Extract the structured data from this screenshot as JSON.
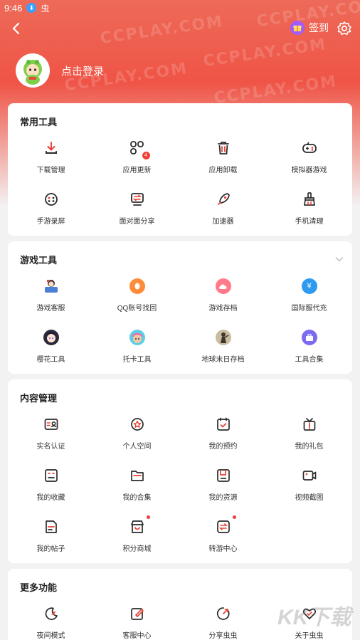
{
  "status": {
    "time": "9:46",
    "app_glyph": "虫"
  },
  "header": {
    "checkin_label": "签到",
    "watermark": "CCPLAY.COM"
  },
  "profile": {
    "login_text": "点击登录"
  },
  "sections": [
    {
      "title": "常用工具",
      "items": [
        {
          "label": "下载管理",
          "icon": "download-icon"
        },
        {
          "label": "应用更新",
          "icon": "apps-update-icon",
          "badge": "4"
        },
        {
          "label": "应用卸载",
          "icon": "trash-icon"
        },
        {
          "label": "模拟器游戏",
          "icon": "gamepad-icon"
        },
        {
          "label": "手游录屏",
          "icon": "record-icon"
        },
        {
          "label": "面对面分享",
          "icon": "share-screen-icon"
        },
        {
          "label": "加速器",
          "icon": "rocket-icon"
        },
        {
          "label": "手机清理",
          "icon": "broom-icon"
        }
      ]
    },
    {
      "title": "游戏工具",
      "items": [
        {
          "label": "游戏客服",
          "icon": "customer-service-icon"
        },
        {
          "label": "QQ账号找回",
          "icon": "qq-icon",
          "color": "#ff8c3a"
        },
        {
          "label": "游戏存档",
          "icon": "cloud-save-icon",
          "color": "#ff7a8a"
        },
        {
          "label": "国际服代充",
          "icon": "yen-icon",
          "color": "#2e9bf0"
        },
        {
          "label": "樱花工具",
          "icon": "sakura-avatar-icon"
        },
        {
          "label": "托卡工具",
          "icon": "toca-avatar-icon"
        },
        {
          "label": "地球末日存档",
          "icon": "doomsday-avatar-icon"
        },
        {
          "label": "工具合集",
          "icon": "toolbox-icon",
          "color": "#7b6bf0"
        }
      ]
    },
    {
      "title": "内容管理",
      "items": [
        {
          "label": "实名认证",
          "icon": "id-card-icon"
        },
        {
          "label": "个人空间",
          "icon": "star-space-icon"
        },
        {
          "label": "我的预约",
          "icon": "calendar-check-icon"
        },
        {
          "label": "我的礼包",
          "icon": "gift-box-icon"
        },
        {
          "label": "我的收藏",
          "icon": "favorites-icon"
        },
        {
          "label": "我的合集",
          "icon": "folder-icon"
        },
        {
          "label": "我的资源",
          "icon": "resource-icon"
        },
        {
          "label": "视频截图",
          "icon": "video-camera-icon"
        },
        {
          "label": "我的帖子",
          "icon": "post-icon"
        },
        {
          "label": "积分商城",
          "icon": "store-icon",
          "dot": true
        },
        {
          "label": "转游中心",
          "icon": "transfer-icon",
          "dot": true
        }
      ]
    },
    {
      "title": "更多功能",
      "items": [
        {
          "label": "夜间模式",
          "icon": "moon-icon"
        },
        {
          "label": "客服中心",
          "icon": "edit-icon"
        },
        {
          "label": "分享虫虫",
          "icon": "share-arc-icon"
        },
        {
          "label": "关于虫虫",
          "icon": "heart-icon"
        }
      ]
    }
  ],
  "brand_watermark": "KK下载",
  "colors": {
    "accent": "#ee4034",
    "header_top": "#ee6a58",
    "icon": "#2b2b2b"
  }
}
